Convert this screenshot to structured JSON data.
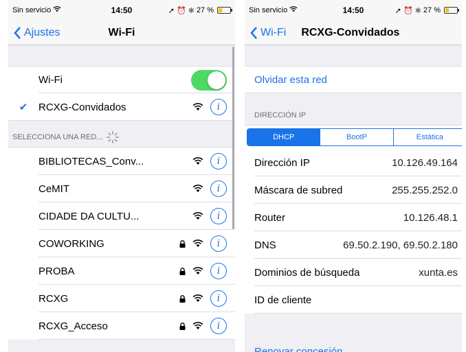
{
  "left": {
    "status": {
      "carrier": "Sin servicio",
      "time": "14:50",
      "battery": "27 %",
      "battery_level": 0.27
    },
    "nav": {
      "back_label": "Ajustes",
      "title": "Wi-Fi"
    },
    "wifi_toggle": {
      "label": "Wi-Fi",
      "on": true
    },
    "connected": {
      "name": "RCXG-Convidados"
    },
    "section_header": "SELECCIONA UNA RED...",
    "networks": [
      {
        "name": "BIBLIOTECAS_Conv...",
        "locked": false
      },
      {
        "name": "CeMIT",
        "locked": false
      },
      {
        "name": "CIDADE DA CULTU...",
        "locked": false
      },
      {
        "name": "COWORKING",
        "locked": true
      },
      {
        "name": "PROBA",
        "locked": true
      },
      {
        "name": "RCXG",
        "locked": true
      },
      {
        "name": "RCXG_Acceso",
        "locked": true
      }
    ]
  },
  "right": {
    "status": {
      "carrier": "Sin servicio",
      "time": "14:50",
      "battery": "27 %",
      "battery_level": 0.27
    },
    "nav": {
      "back_label": "Wi-Fi",
      "title": "RCXG-Convidados"
    },
    "forget_label": "Olvidar esta red",
    "ip_header": "DIRECCIÓN IP",
    "segments": [
      "DHCP",
      "BootP",
      "Estática"
    ],
    "selected_segment": "DHCP",
    "fields": [
      {
        "label": "Dirección IP",
        "value": "10.126.49.164"
      },
      {
        "label": "Máscara de subred",
        "value": "255.255.252.0"
      },
      {
        "label": "Router",
        "value": "10.126.48.1"
      },
      {
        "label": "DNS",
        "value": "69.50.2.190, 69.50.2.180"
      },
      {
        "label": "Dominios de búsqueda",
        "value": "xunta.es"
      },
      {
        "label": "ID de cliente",
        "value": ""
      }
    ],
    "renew_label": "Renovar concesión"
  },
  "colors": {
    "accent": "#1a73e8",
    "toggle_on": "#4cd964",
    "background": "#efeff4"
  }
}
